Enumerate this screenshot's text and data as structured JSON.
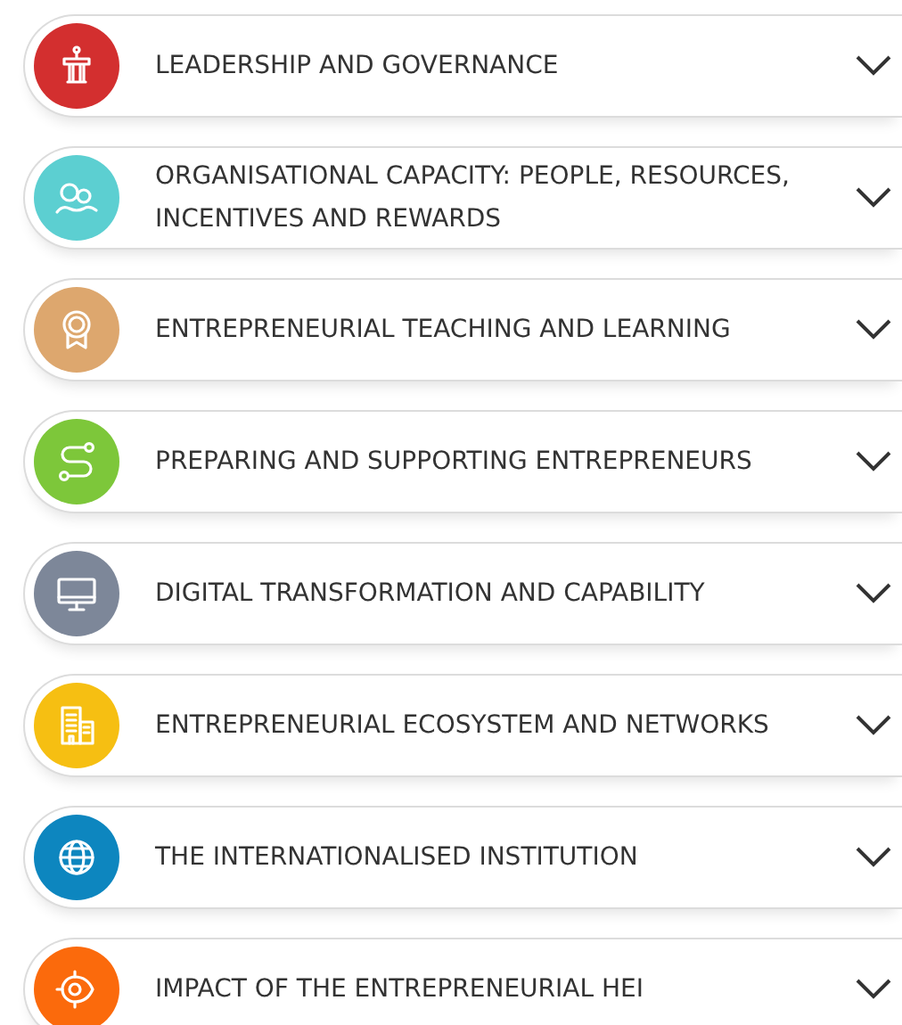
{
  "sections": [
    {
      "title": "LEADERSHIP AND GOVERNANCE",
      "color": "#d32f2f",
      "expanded": false
    },
    {
      "title": "ORGANISATIONAL CAPACITY: PEOPLE, RESOURCES, INCENTIVES AND REWARDS",
      "color": "#5ccfd1",
      "expanded": false
    },
    {
      "title": "ENTREPRENEURIAL TEACHING AND LEARNING",
      "color": "#dda76e",
      "expanded": false
    },
    {
      "title": "PREPARING AND SUPPORTING ENTREPRENEURS",
      "color": "#7dc73a",
      "expanded": false
    },
    {
      "title": "DIGITAL TRANSFORMATION AND CAPABILITY",
      "color": "#7d8799",
      "expanded": false
    },
    {
      "title": "ENTREPRENEURIAL ECOSYSTEM AND NETWORKS",
      "color": "#f6bf12",
      "expanded": false
    },
    {
      "title": "THE INTERNATIONALISED INSTITUTION",
      "color": "#0d86bf",
      "expanded": false
    },
    {
      "title": "IMPACT OF THE ENTREPRENEURIAL HEI",
      "color": "#fb6a0c",
      "expanded": false
    }
  ]
}
